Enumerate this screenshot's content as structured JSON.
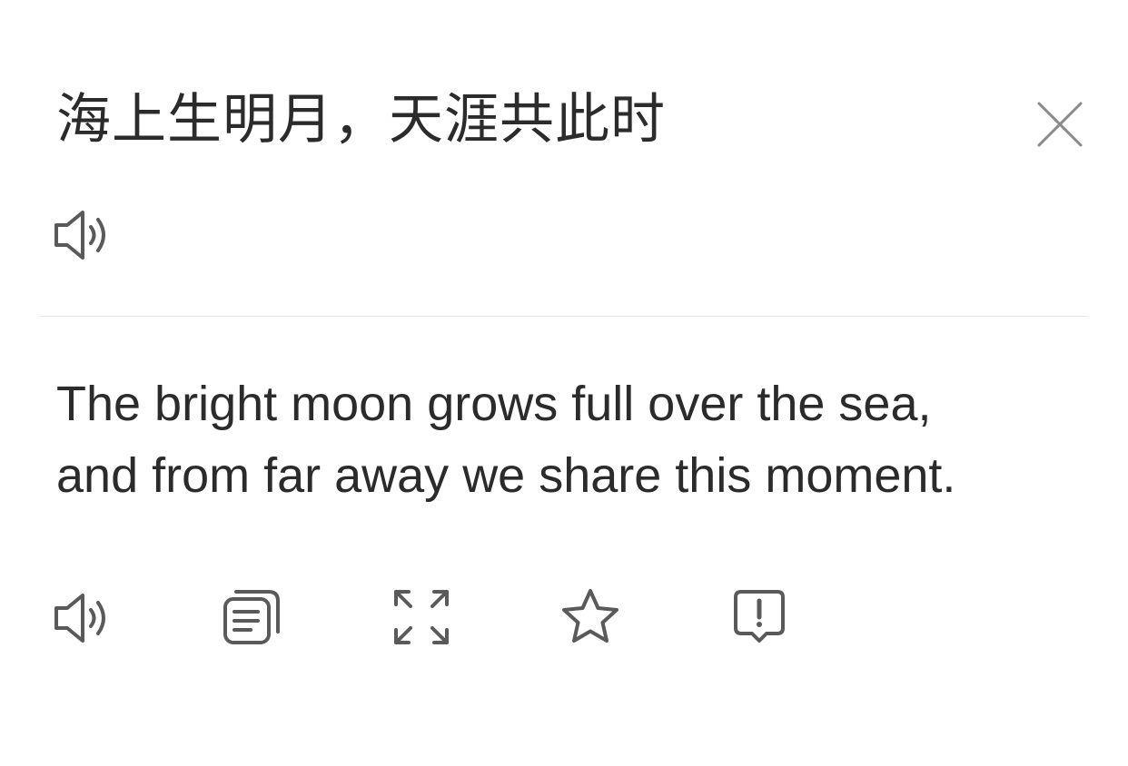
{
  "source": {
    "text": "海上生明月，天涯共此时"
  },
  "translation": {
    "line1": "The bright moon grows full over the sea,",
    "line2": "and from far away we share this moment."
  },
  "icons": {
    "close": "close-icon",
    "speak_source": "speaker-icon",
    "speak_translation": "speaker-icon",
    "copy": "copy-icon",
    "expand": "expand-icon",
    "favorite": "star-icon",
    "feedback": "report-icon"
  },
  "colors": {
    "text": "#2b2b2b",
    "icon": "#5a5a5a",
    "close": "#8a8a8a",
    "divider": "#e6e6e6",
    "background": "#ffffff"
  }
}
